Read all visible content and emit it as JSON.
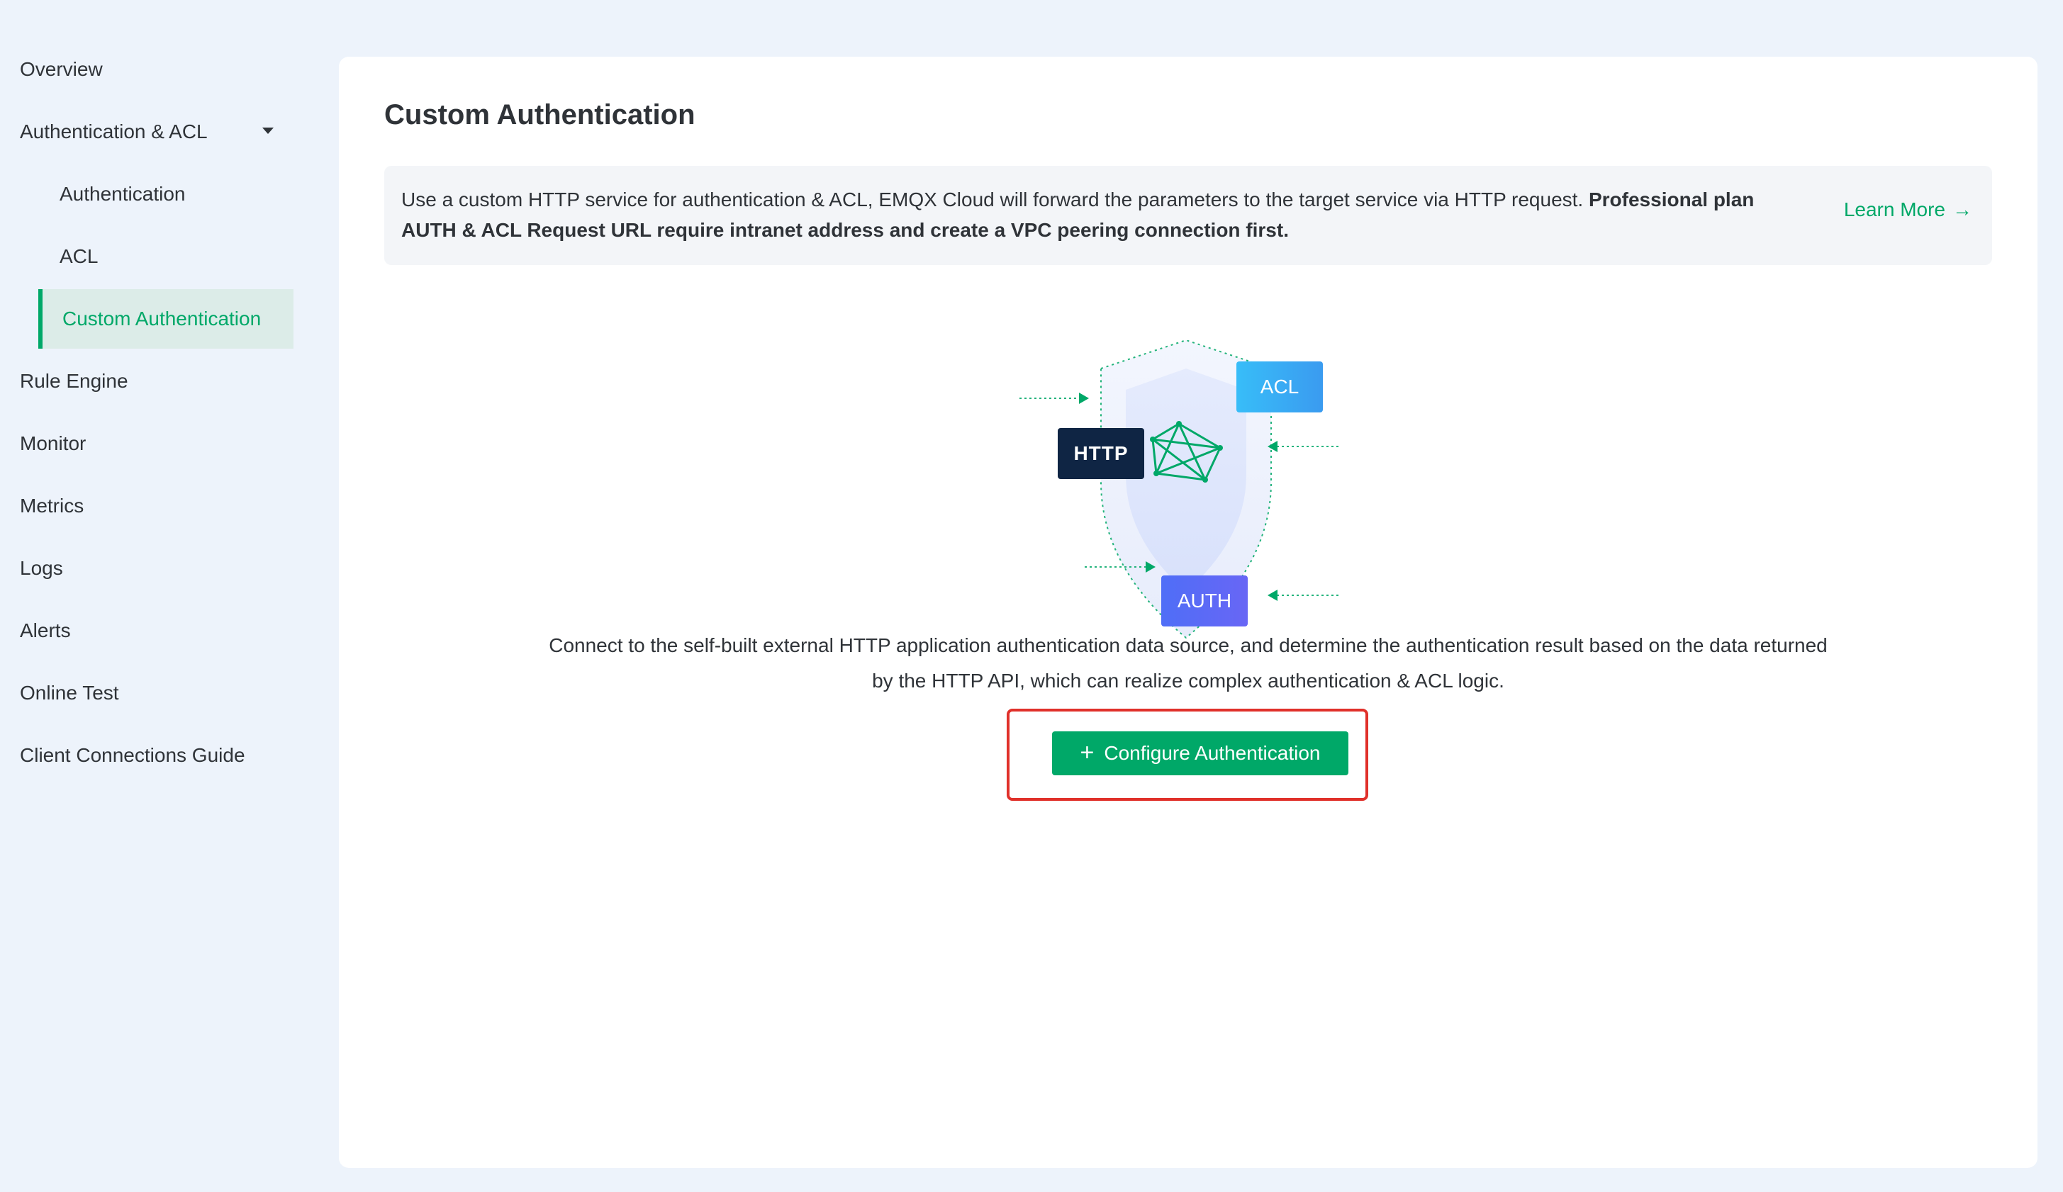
{
  "sidebar": {
    "items": [
      {
        "label": "Overview"
      },
      {
        "label": "Authentication & ACL"
      },
      {
        "label": "Authentication"
      },
      {
        "label": "ACL"
      },
      {
        "label": "Custom Authentication"
      },
      {
        "label": "Rule Engine"
      },
      {
        "label": "Monitor"
      },
      {
        "label": "Metrics"
      },
      {
        "label": "Logs"
      },
      {
        "label": "Alerts"
      },
      {
        "label": "Online Test"
      },
      {
        "label": "Client Connections Guide"
      }
    ]
  },
  "main": {
    "title": "Custom Authentication",
    "info": {
      "text": "Use a custom HTTP service for authentication & ACL, EMQX Cloud will forward the parameters to the target service via HTTP request. ",
      "bold": "Professional plan AUTH & ACL Request URL require intranet address and create a VPC peering connection first.",
      "learn_more": "Learn More",
      "learn_more_arrow": "→"
    },
    "illustration": {
      "acl": "ACL",
      "http": "HTTP",
      "auth": "AUTH"
    },
    "description": {
      "line1": "Connect to the self-built external HTTP application authentication data source, and determine the authentication result based on the data returned",
      "line2": "by the HTTP API, which can realize complex authentication & ACL logic."
    },
    "button": {
      "icon": "+",
      "label": "Configure Authentication"
    }
  },
  "colors": {
    "accent": "#00a868",
    "page_bg": "#edf3fb",
    "highlight": "#e0302a",
    "http_tag": "#0f2544"
  }
}
